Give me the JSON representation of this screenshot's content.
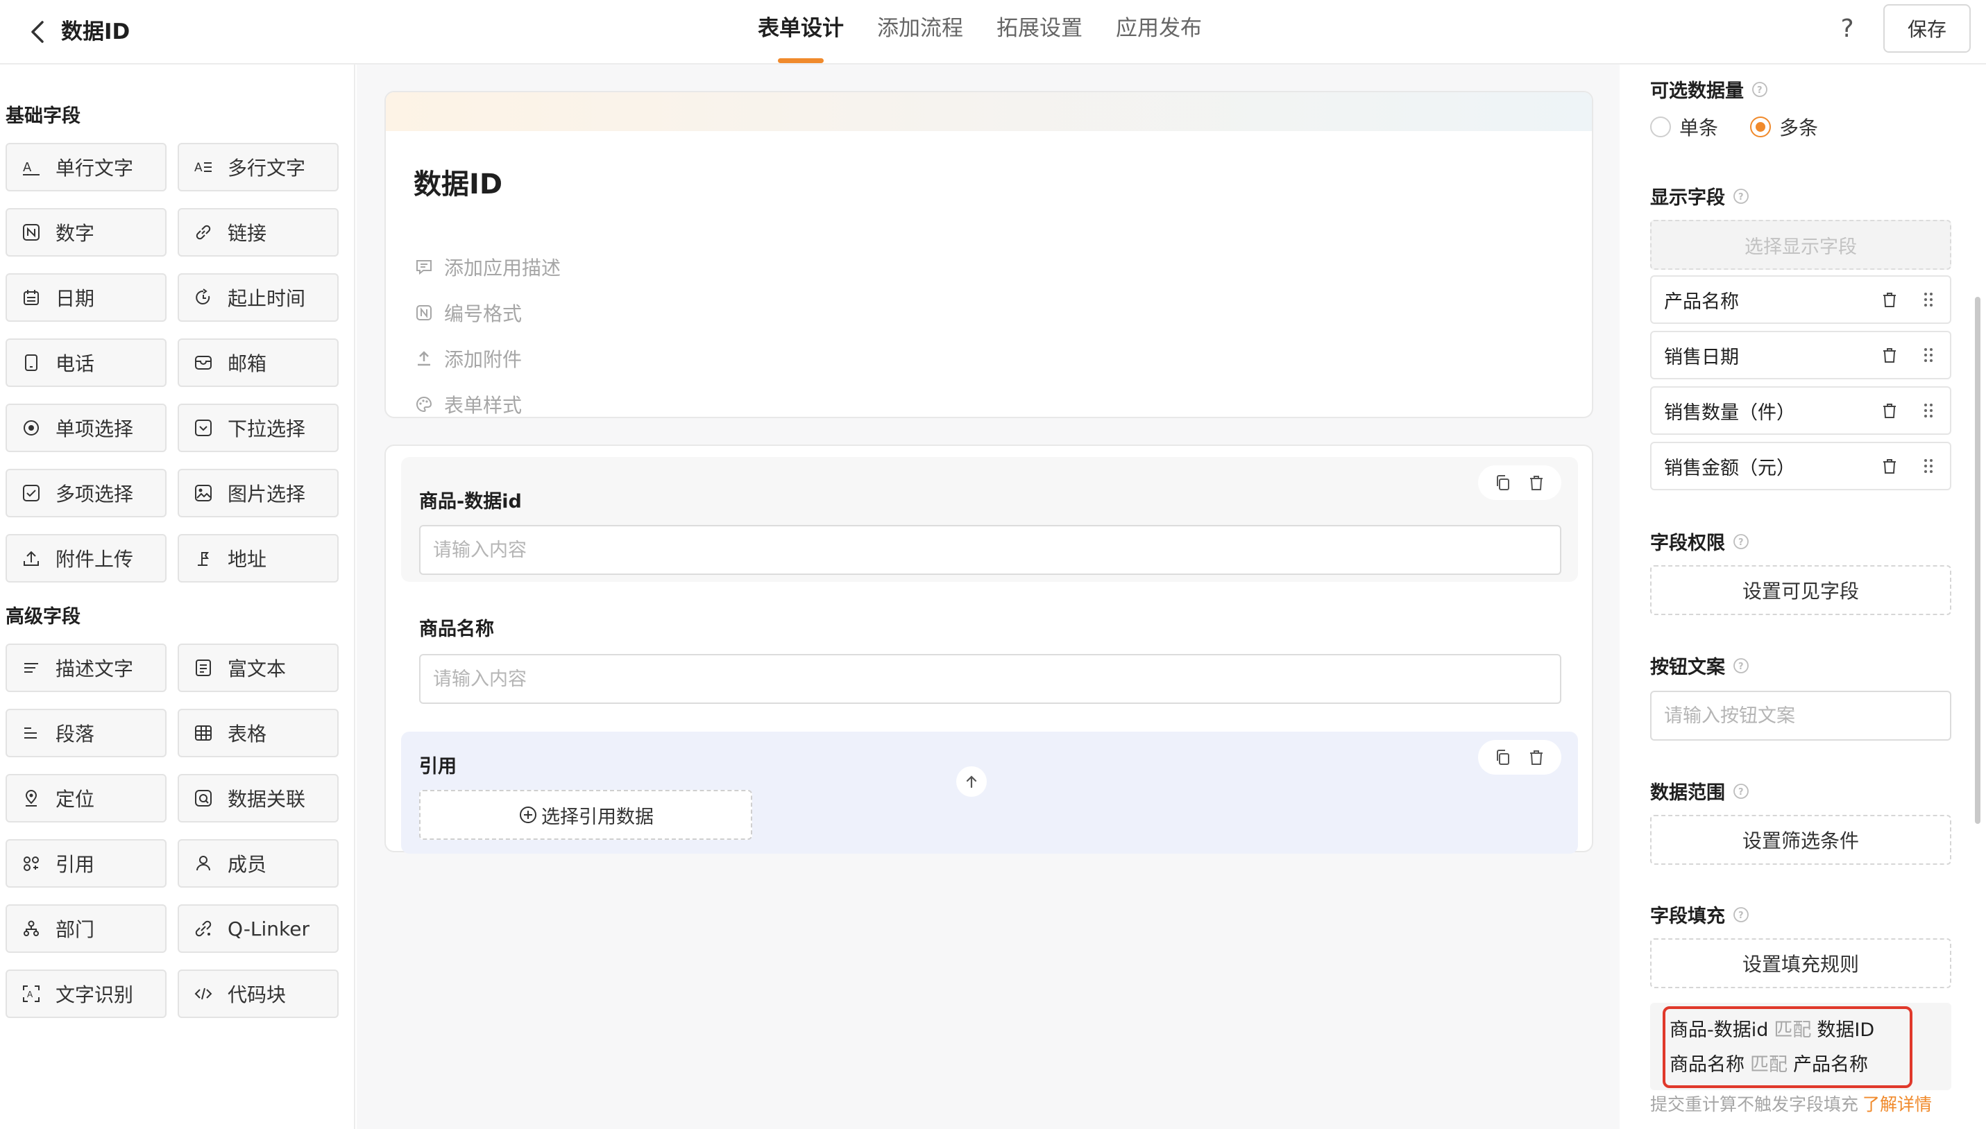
{
  "header": {
    "title": "数据ID",
    "tabs": [
      {
        "label": "表单设计",
        "active": true
      },
      {
        "label": "添加流程",
        "active": false
      },
      {
        "label": "拓展设置",
        "active": false
      },
      {
        "label": "应用发布",
        "active": false
      }
    ],
    "help": "?",
    "save_label": "保存"
  },
  "left": {
    "basic_title": "基础字段",
    "basic_fields": [
      "单行文字",
      "多行文字",
      "数字",
      "链接",
      "日期",
      "起止时间",
      "电话",
      "邮箱",
      "单项选择",
      "下拉选择",
      "多项选择",
      "图片选择",
      "附件上传",
      "地址"
    ],
    "advanced_title": "高级字段",
    "advanced_fields": [
      "描述文字",
      "富文本",
      "段落",
      "表格",
      "定位",
      "数据关联",
      "引用",
      "成员",
      "部门",
      "Q-Linker",
      "文字识别",
      "代码块"
    ]
  },
  "form": {
    "title": "数据ID",
    "meta": [
      "添加应用描述",
      "编号格式",
      "添加附件",
      "表单样式"
    ],
    "fields": [
      {
        "label": "商品-数据id",
        "placeholder": "请输入内容"
      },
      {
        "label": "商品名称",
        "placeholder": "请输入内容"
      }
    ],
    "reference": {
      "label": "引用",
      "button": "选择引用数据"
    }
  },
  "props": {
    "quantity_title": "可选数据量",
    "quantity_options": [
      "单条",
      "多条"
    ],
    "quantity_selected": "多条",
    "display_title": "显示字段",
    "display_select": "选择显示字段",
    "display_fields": [
      "产品名称",
      "销售日期",
      "销售数量（件）",
      "销售金额（元）"
    ],
    "permission_title": "字段权限",
    "permission_button": "设置可见字段",
    "button_text_title": "按钮文案",
    "button_text_placeholder": "请输入按钮文案",
    "range_title": "数据范围",
    "range_button": "设置筛选条件",
    "fill_title": "字段填充",
    "fill_button": "设置填充规则",
    "fill_rules": [
      {
        "source": "商品-数据id",
        "op": "匹配",
        "target": "数据ID"
      },
      {
        "source": "商品名称",
        "op": "匹配",
        "target": "产品名称"
      }
    ],
    "hint": "提交重计算不触发字段填充",
    "hint_link": "了解详情",
    "accent_color": "#f08a2c",
    "highlight_color": "#e0392b"
  }
}
